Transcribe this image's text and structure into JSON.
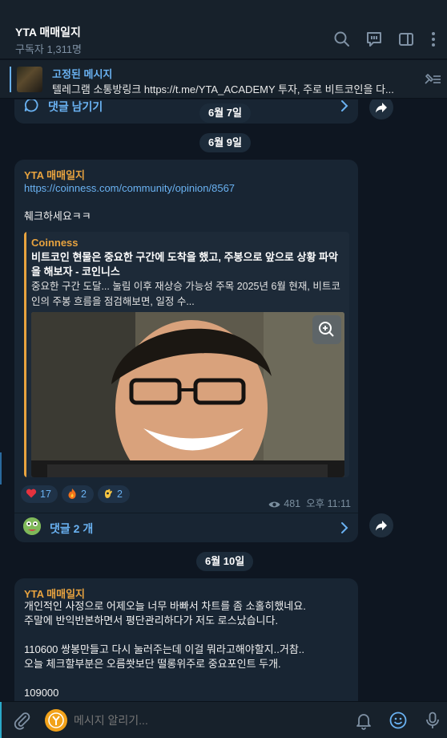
{
  "header": {
    "title": "YTA 매매일지",
    "subtitle": "구독자 1,311명"
  },
  "pinned": {
    "title": "고정된 메시지",
    "text": "텔레그램 소통방링크 https://t.me/YTA_ACADEMY 투자, 주로 비트코인을 다..."
  },
  "prev_post": {
    "comment_label": "댓글 남기기"
  },
  "dates": [
    "6월 7일",
    "6월 9일",
    "6월 10일"
  ],
  "post1": {
    "author": "YTA 매매일지",
    "link": "https://coinness.com/community/opinion/8567",
    "text": "췌크하세요ㅋㅋ",
    "preview": {
      "site": "Coinness",
      "title": "비트코인 현물은 중요한 구간에 도착을 했고, 주봉으로 앞으로 상황 파악을 해보자 - 코인니스",
      "desc": "중요한 구간 도달... 눌림 이후  재상승  가능성 주목      2025년 6월 현재, 비트코인의 주봉 흐름을 점검해보면, 일정 수..."
    },
    "reactions": [
      {
        "emoji": "heart-emoji",
        "count": "17"
      },
      {
        "emoji": "fire-emoji",
        "count": "2"
      },
      {
        "emoji": "ok-hand-emoji",
        "count": "2"
      }
    ],
    "views": "481",
    "time": "오후 11:11",
    "comments": "댓글 2 개"
  },
  "post2": {
    "author": "YTA 매매일지",
    "lines": [
      "개인적인 사정으로 어제오늘 너무 바빠서 차트를 좀 소홀히했네요.",
      "주말에 반익반본하면서 평단관리하다가 저도 로스났습니다.",
      "",
      "110600 쌍봉만들고 다시 눌러주는데 이걸 뭐라고해야할지..거참..",
      "오늘 체크할부분은 오름쐇보단 떨롱위주로 중요포인트 두개.",
      "",
      "109000"
    ]
  },
  "input": {
    "placeholder": "메시지 알리기..."
  },
  "colors": {
    "background": "#0e1621",
    "bubble": "#182533",
    "accent": "#6ab2f2",
    "author": "#e8a33f"
  }
}
